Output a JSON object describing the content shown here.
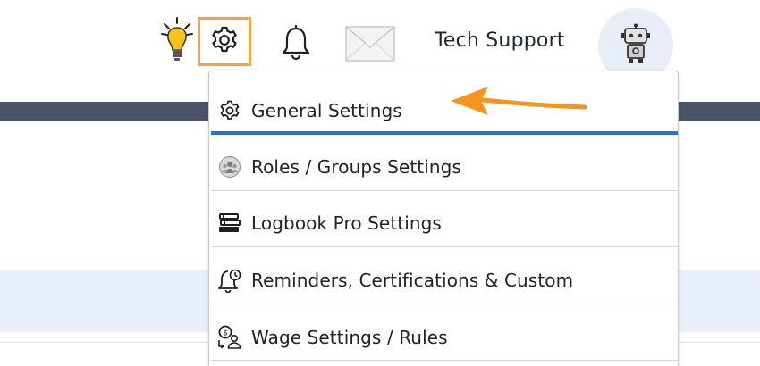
{
  "header": {
    "icons": [
      "lightbulb-icon",
      "gear-icon",
      "bell-icon",
      "mail-icon"
    ],
    "user_name": "Tech Support",
    "avatar_icon": "robot-icon"
  },
  "settings_menu": {
    "items": [
      {
        "label": "General Settings",
        "icon": "gear-icon",
        "active": true
      },
      {
        "label": "Roles / Groups Settings",
        "icon": "group-icon"
      },
      {
        "label": "Logbook Pro Settings",
        "icon": "books-icon"
      },
      {
        "label": "Reminders, Certifications & Custom",
        "icon": "reminder-bell-icon"
      },
      {
        "label": "Wage Settings / Rules",
        "icon": "wage-icon"
      }
    ]
  },
  "annotation": {
    "icon": "orange-arrow-icon"
  },
  "colors": {
    "highlight_orange": "#f3a43d",
    "active_blue": "#2a6fe0",
    "nav_dark": "#4a5468",
    "panel_light": "#e9f0fb"
  }
}
